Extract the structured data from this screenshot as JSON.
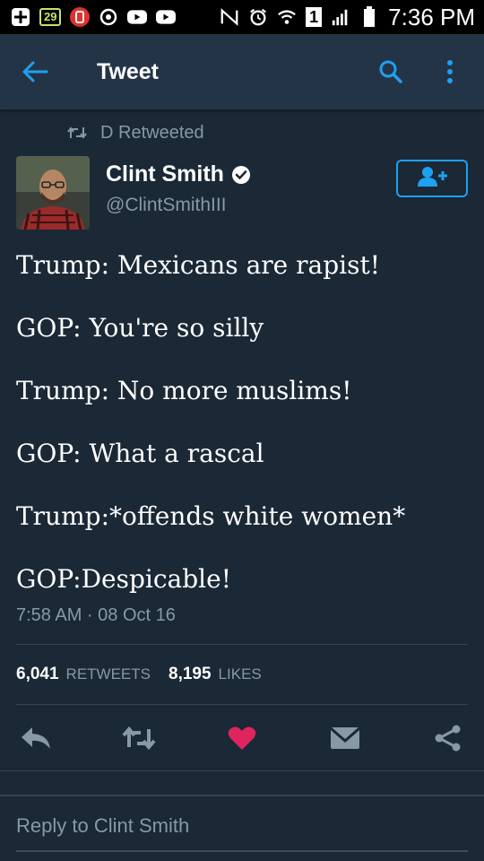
{
  "status_bar": {
    "badge": "29",
    "sim": "1",
    "time": "7:36 PM"
  },
  "appbar": {
    "title": "Tweet"
  },
  "tweet": {
    "retweeted_by": "D Retweeted",
    "author_name": "Clint Smith",
    "author_handle": "@ClintSmithIII",
    "lines": [
      "Trump: Mexicans are rapist!",
      "GOP: You're so silly",
      "Trump: No more muslims!",
      "GOP: What a rascal",
      "Trump:*offends white women*",
      "GOP:Despicable!"
    ],
    "timestamp": "7:58 AM · 08 Oct 16",
    "retweets_count": "6,041",
    "retweets_label": "RETWEETS",
    "likes_count": "8,195",
    "likes_label": "LIKES"
  },
  "reply": {
    "placeholder": "Reply to Clint Smith"
  },
  "colors": {
    "accent": "#1da1f2",
    "like": "#e0245e",
    "muted": "#8899a6",
    "bg": "#1b2836"
  }
}
